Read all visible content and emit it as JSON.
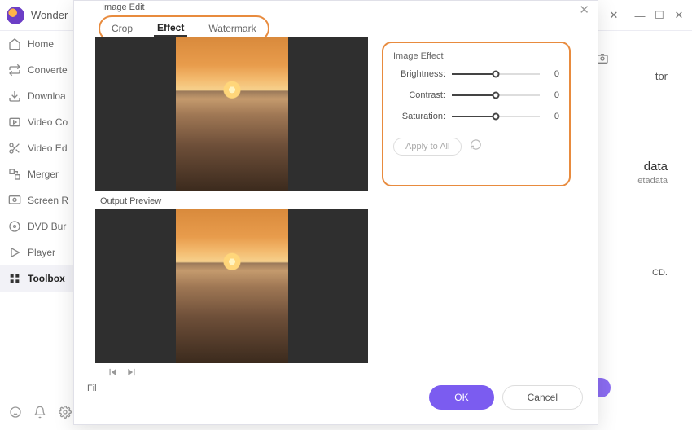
{
  "app": {
    "title": "Wonder"
  },
  "window": {
    "close1": "✕",
    "close2": "✕",
    "min": "—",
    "max": "☐"
  },
  "sidebar": {
    "items": [
      {
        "label": "Home"
      },
      {
        "label": "Converte"
      },
      {
        "label": "Downloa"
      },
      {
        "label": "Video Co"
      },
      {
        "label": "Video Ed"
      },
      {
        "label": "Merger"
      },
      {
        "label": "Screen R"
      },
      {
        "label": "DVD Bur"
      },
      {
        "label": "Player"
      },
      {
        "label": "Toolbox"
      }
    ]
  },
  "right_panel": {
    "hint1": "tor",
    "hint2": "data",
    "hint3": "etadata",
    "hint4": "CD."
  },
  "modal": {
    "title": "Image Edit",
    "close": "✕",
    "tabs": {
      "crop": "Crop",
      "effect": "Effect",
      "watermark": "Watermark"
    },
    "output_label": "Output Preview",
    "fx": {
      "title": "Image Effect",
      "brightness": {
        "label": "Brightness:",
        "value": "0"
      },
      "contrast": {
        "label": "Contrast:",
        "value": "0"
      },
      "saturation": {
        "label": "Saturation:",
        "value": "0"
      },
      "apply_all": "Apply to All"
    },
    "file_label": "Fil",
    "buttons": {
      "ok": "OK",
      "cancel": "Cancel"
    }
  }
}
